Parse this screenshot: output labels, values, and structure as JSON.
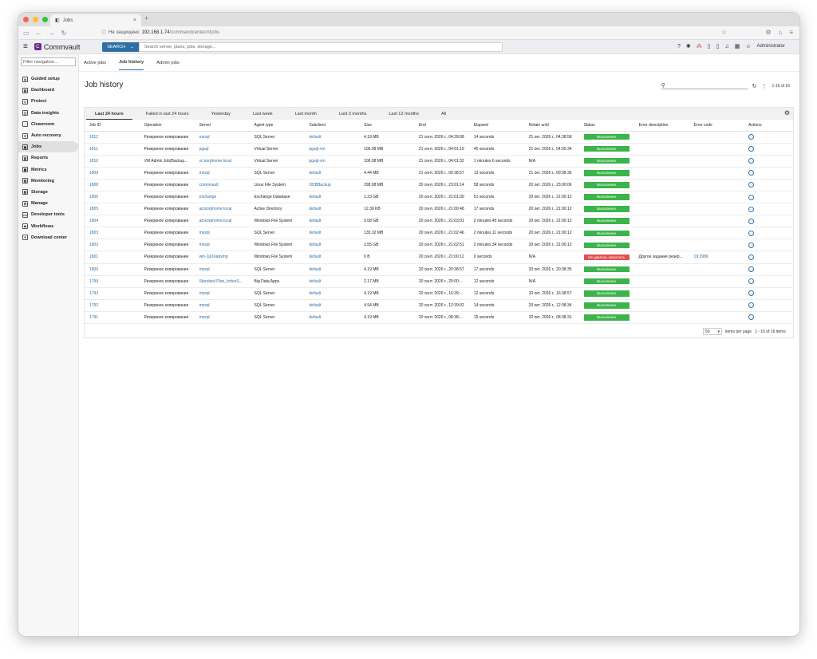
{
  "browser": {
    "tab_title": "Jobs",
    "security": "Не защищено",
    "url_host": "192.168.1.74",
    "url_path": "/commandcenter/#/jobs"
  },
  "header": {
    "brand": "Commvault",
    "search_label": "SEARCH",
    "search_placeholder": "Search server, plans, jobs, storage...",
    "user": "Administrator"
  },
  "sidebar": {
    "filter_placeholder": "Filter navigation...",
    "items": [
      {
        "label": "Guided setup"
      },
      {
        "label": "Dashboard"
      },
      {
        "label": "Protect"
      },
      {
        "label": "Data insights"
      },
      {
        "label": "Cleanroom"
      },
      {
        "label": "Auto recovery"
      },
      {
        "label": "Jobs"
      },
      {
        "label": "Reports"
      },
      {
        "label": "Metrics"
      },
      {
        "label": "Monitoring"
      },
      {
        "label": "Storage"
      },
      {
        "label": "Manage"
      },
      {
        "label": "Developer tools"
      },
      {
        "label": "Workflows"
      },
      {
        "label": "Download center"
      }
    ]
  },
  "tabs": [
    "Active jobs",
    "Job history",
    "Admin jobs"
  ],
  "page_title": "Job history",
  "count_label": "1-16 of 16",
  "filters": [
    "Last 24 hours",
    "Failed in last 24 hours",
    "Yesterday",
    "Last week",
    "Last month",
    "Last 3 months",
    "Last 12 months",
    "All"
  ],
  "columns": [
    "Job ID",
    "Operation",
    "Server",
    "Agent type",
    "Subclient",
    "Size",
    "End",
    "Elapsed",
    "Retain until",
    "Status",
    "Error description",
    "Error code",
    "Actions"
  ],
  "rows": [
    [
      "1812",
      "Резервное копирование",
      "mssql",
      "SQL Server",
      "default",
      "4.19 MB",
      "21 сент. 2026 г., 04:39:08",
      "14 seconds",
      "21 окт. 2026 г., 04:38:58",
      "Выполнено",
      "",
      ""
    ],
    [
      "1811",
      "Резервное копирование",
      "pgsql",
      "Virtual Server",
      "pgsql-vm",
      "106.08 MB",
      "21 сент. 2026 г., 04:01:19",
      "45 seconds",
      "21 окт. 2026 г., 04:00:34",
      "Выполнено",
      "",
      ""
    ],
    [
      "1810",
      "VM Admin Job(Backup...",
      "vc.korphome.local",
      "Virtual Server",
      "pgsql-vm",
      "106.08 MB",
      "21 сент. 2026 г., 04:01:32",
      "1 minutes 6 seconds",
      "N/A",
      "Выполнено",
      "",
      ""
    ],
    [
      "1809",
      "Резервное копирование",
      "mssql",
      "SQL Server",
      "default",
      "4.44 MB",
      "21 сент. 2026 г., 00:38:57",
      "13 seconds",
      "21 окт. 2026 г., 00:38:35",
      "Выполнено",
      "",
      ""
    ],
    [
      "1808",
      "Резервное копирование",
      "commvault",
      "Linux File System",
      "DDBBackup",
      "298.08 MB",
      "20 сент. 2026 г., 23:01:14",
      "58 seconds",
      "20 окт. 2026 г., 23:00:06",
      "Выполнено",
      "",
      ""
    ],
    [
      "1806",
      "Резервное копирование",
      "exchange",
      "Exchange Database",
      "default",
      "1.23 GB",
      "20 сент. 2026 г., 21:01:30",
      "51 seconds",
      "20 окт. 2026 г., 21:00:12",
      "Выполнено",
      "",
      ""
    ],
    [
      "1805",
      "Резервное копирование",
      "ad.korphome.local",
      "Active Directory",
      "default",
      "12.39 KB",
      "20 сент. 2026 г., 21:00:48",
      "17 seconds",
      "20 окт. 2026 г., 21:00:12",
      "Выполнено",
      "",
      ""
    ],
    [
      "1804",
      "Резервное копирование",
      "ad.korphome.local",
      "Windows File System",
      "default",
      "5.08 GB",
      "20 сент. 2026 г., 21:03:01",
      "2 minutes 45 seconds",
      "20 окт. 2026 г., 21:00:12",
      "Выполнено",
      "",
      ""
    ],
    [
      "1803",
      "Резервное копирование",
      "mssql",
      "SQL Server",
      "default",
      "135.32 MB",
      "20 сент. 2026 г., 21:02:46",
      "2 minutes 11 seconds",
      "20 окт. 2026 г., 21:00:12",
      "Выполнено",
      "",
      ""
    ],
    [
      "1802",
      "Резервное копирование",
      "mssql",
      "Windows File System",
      "default",
      "2.55 GB",
      "20 сент. 2026 г., 21:02:51",
      "2 minutes 34 seconds",
      "20 окт. 2026 г., 21:00:12",
      "Выполнено",
      "",
      ""
    ],
    [
      "1801",
      "Резервное копирование",
      "win-1jn1kaqvmp",
      "Windows File System",
      "default",
      "0 B",
      "20 сент. 2026 г., 21:00:12",
      "0 seconds",
      "N/A",
      "Не удалось запустить",
      "Другое задание резер...",
      "19:2986"
    ],
    [
      "1800",
      "Резервное копирование",
      "mssql",
      "SQL Server",
      "default",
      "4.19 MB",
      "20 сент. 2026 г., 20:38:57",
      "17 seconds",
      "20 окт. 2026 г., 20:38:35",
      "Выполнено",
      "",
      ""
    ],
    [
      "1799",
      "Резервное копирование",
      "Standard Plan_IndexS...",
      "Big Data Apps",
      "default",
      "2.17 MB",
      "20 сент. 2026 г., 20:00:...",
      "12 seconds",
      "N/A",
      "Выполнено",
      "",
      ""
    ],
    [
      "1793",
      "Резервное копирование",
      "mssql",
      "SQL Server",
      "default",
      "4.19 MB",
      "20 сент. 2026 г., 16:39:...",
      "12 seconds",
      "20 окт. 2026 г., 16:38:57",
      "Выполнено",
      "",
      ""
    ],
    [
      "1792",
      "Резервное копирование",
      "mssql",
      "SQL Server",
      "default",
      "4.94 MB",
      "20 сент. 2026 г., 12:39:02",
      "14 seconds",
      "20 окт. 2026 г., 12:38:34",
      "Выполнено",
      "",
      ""
    ],
    [
      "1791",
      "Резервное копирование",
      "mssql",
      "SQL Server",
      "default",
      "4.19 MB",
      "20 сент. 2026 г., 08:38:...",
      "15 seconds",
      "20 окт. 2026 г., 08:38:31",
      "Выполнено",
      "",
      ""
    ]
  ],
  "status_colors": {
    "ok": "#3cb44b",
    "fail": "#e05050"
  },
  "pager": {
    "page_size": "50",
    "items_label": "items per page",
    "range": "1 - 16 of 16 items"
  }
}
